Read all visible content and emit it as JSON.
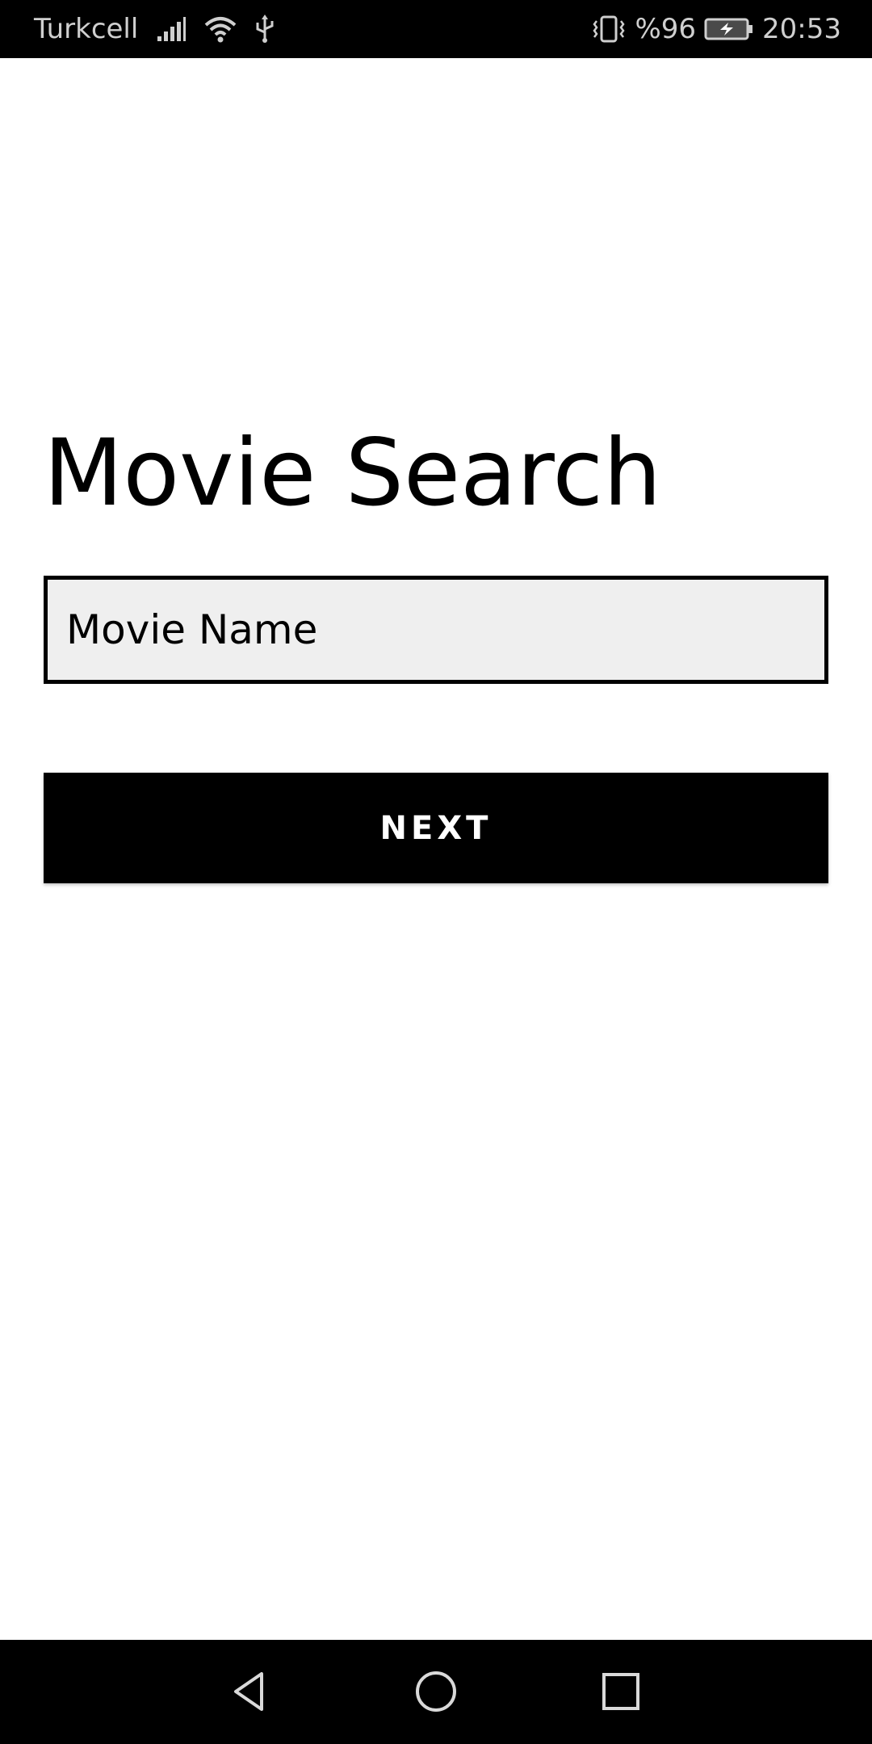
{
  "status_bar": {
    "carrier": "Turkcell",
    "battery_percent": "%96",
    "time": "20:53",
    "icons": [
      "signal-icon",
      "wifi-icon",
      "usb-icon",
      "vibrate-icon",
      "battery-charging-icon"
    ]
  },
  "main": {
    "title": "Movie Search",
    "search": {
      "placeholder": "Movie Name",
      "value": ""
    },
    "next_label": "NEXT"
  },
  "nav_bar": {
    "icons": [
      "back-icon",
      "home-icon",
      "recents-icon"
    ]
  },
  "colors": {
    "background": "#ffffff",
    "bars": "#000000",
    "input_background": "#efefef",
    "button_background": "#000000",
    "button_text": "#ffffff"
  }
}
